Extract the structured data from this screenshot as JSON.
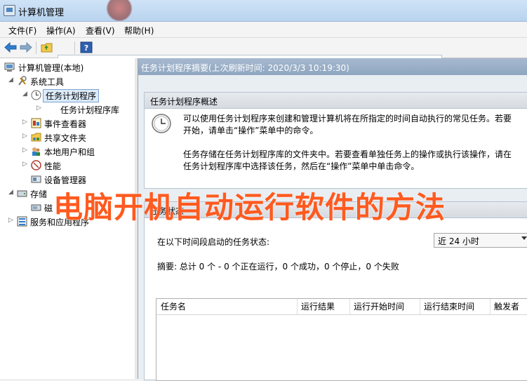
{
  "window": {
    "title": "计算机管理"
  },
  "menu": [
    "文件(F)",
    "操作(A)",
    "查看(V)",
    "帮助(H)"
  ],
  "tree": {
    "root": "计算机管理(本地)",
    "system_tools": "系统工具",
    "task_scheduler": "任务计划程序",
    "task_scheduler_library": "任务计划程序库",
    "event_viewer": "事件查看器",
    "shared_folders": "共享文件夹",
    "local_users": "本地用户和组",
    "performance": "性能",
    "device_manager": "设备管理器",
    "storage": "存储",
    "disk": "磁",
    "services": "服务和应用程序"
  },
  "main": {
    "header": "任务计划程序摘要(上次刷新时间: 2020/3/3 10:19:30)",
    "overview_title": "任务计划程序概述",
    "overview_line1": "可以使用任务计划程序来创建和管理计算机将在所指定的时间自动执行的常见任务。若要",
    "overview_line2": "开始，请单击“操作”菜单中的命令。",
    "overview_line3": "任务存储在任务计划程序库的文件夹中。若要查看单独任务上的操作或执行该操作，请在",
    "overview_line4": "任务计划程序库中选择该任务，然后在“操作”菜单中单击命令。",
    "status_title": "任务状态",
    "status_label": "在以下时间段启动的任务状态:",
    "period": "近 24 小时",
    "summary": "摘要: 总计 0 个 - 0 个正在运行，0 个成功，0 个停止，0 个失败",
    "columns": [
      "任务名",
      "运行结果",
      "运行开始时间",
      "运行结束时间",
      "触发者"
    ]
  },
  "overlay": {
    "caption": "电脑开机自动运行软件的方法"
  }
}
